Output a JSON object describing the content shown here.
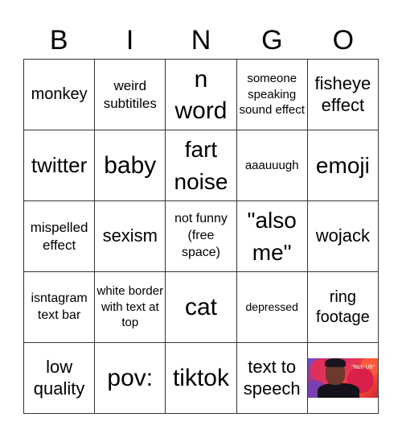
{
  "header": {
    "letters": [
      "B",
      "I",
      "N",
      "G",
      "O"
    ]
  },
  "board": {
    "cells": [
      [
        "monkey",
        "weird subtitiles",
        "n word",
        "someone speaking sound effect",
        "fisheye effect"
      ],
      [
        "twitter",
        "baby",
        "fart noise",
        "aaauuugh",
        "emoji"
      ],
      [
        "mispelled effect",
        "sexism",
        "not funny (free space)",
        "\"also me\"",
        "wojack"
      ],
      [
        "isntagram text bar",
        "white border with text at top",
        "cat",
        "depressed",
        "ring footage"
      ],
      [
        "low quality",
        "pov:",
        "tiktok",
        "text to speech",
        ""
      ]
    ],
    "image_cell": {
      "icon": "meme-image",
      "caption": "\"Nuh Uh\""
    }
  }
}
